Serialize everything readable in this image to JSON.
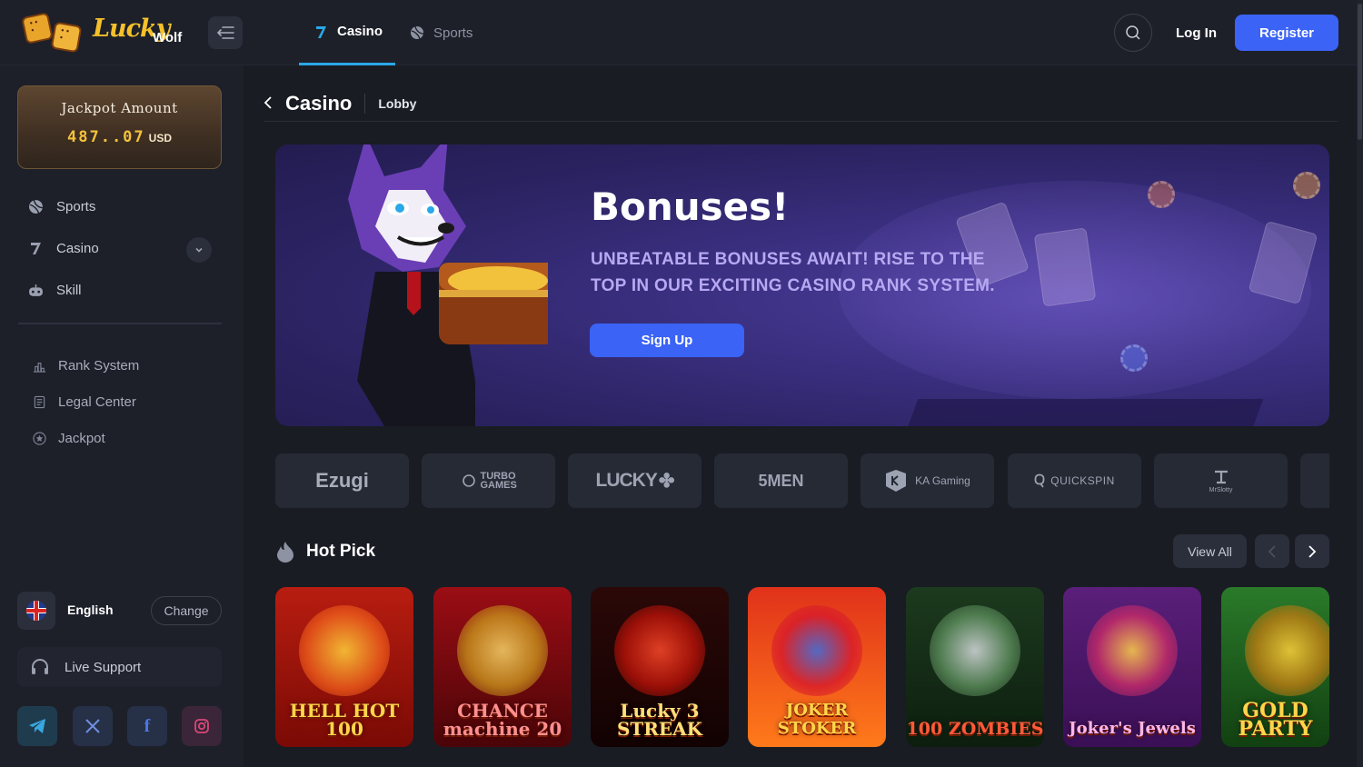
{
  "header": {
    "logo_text": "Lucky",
    "logo_sub": "Wolf",
    "tabs": [
      {
        "label": "Casino",
        "icon": "seven-icon",
        "active": true
      },
      {
        "label": "Sports",
        "icon": "ball-icon",
        "active": false
      }
    ],
    "login_label": "Log In",
    "register_label": "Register"
  },
  "sidebar": {
    "jackpot": {
      "title": "Jackpot Amount",
      "value": "487..07",
      "currency": "USD"
    },
    "items": [
      {
        "label": "Sports",
        "icon": "ball-icon"
      },
      {
        "label": "Casino",
        "icon": "seven-icon"
      },
      {
        "label": "Skill",
        "icon": "gamepad-icon"
      }
    ],
    "secondary": [
      {
        "label": "Rank System",
        "icon": "rank-icon"
      },
      {
        "label": "Legal Center",
        "icon": "document-icon"
      },
      {
        "label": "Jackpot",
        "icon": "star-icon"
      }
    ],
    "language": {
      "name": "English",
      "change_label": "Change"
    },
    "support_label": "Live Support",
    "social": [
      "telegram-icon",
      "x-icon",
      "facebook-icon",
      "instagram-icon"
    ]
  },
  "main": {
    "title": "Casino",
    "breadcrumb": "Lobby",
    "banner": {
      "title": "Bonuses!",
      "subtitle": "UNBEATABLE BONUSES AWAIT! RISE TO THE TOP IN OUR EXCITING CASINO RANK SYSTEM.",
      "cta_label": "Sign Up"
    },
    "providers": [
      "Ezugi",
      "TURBO GAMES",
      "LUCKY",
      "5MEN",
      "KA Gaming",
      "QUICKSPIN",
      "MrSlotty"
    ],
    "hot_pick": {
      "title": "Hot Pick",
      "view_all_label": "View All",
      "games": [
        {
          "name": "HELL HOT 100"
        },
        {
          "name": "CHANCE machine 20"
        },
        {
          "name": "Lucky 3 STREAK"
        },
        {
          "name": "JOKER STOKER"
        },
        {
          "name": "100 ZOMBIES"
        },
        {
          "name": "Joker's Jewels"
        },
        {
          "name": "GOLD PARTY"
        }
      ]
    }
  },
  "colors": {
    "accent": "#3b63f5",
    "tab_indicator": "#2aa8e8",
    "jackpot_gold": "#f3c23c"
  }
}
